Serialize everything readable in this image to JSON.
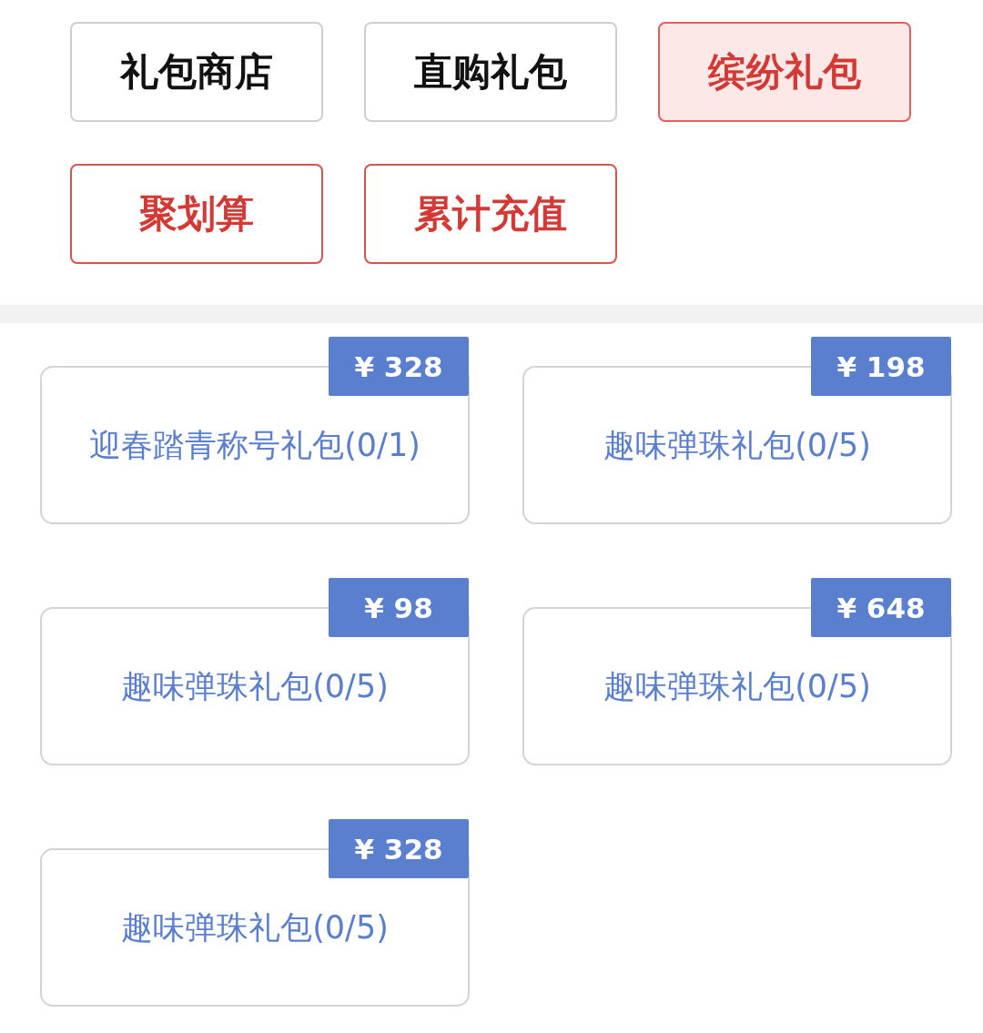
{
  "tabs": [
    {
      "label": "礼包商店",
      "kind": "plain",
      "selected": false
    },
    {
      "label": "直购礼包",
      "kind": "plain",
      "selected": false
    },
    {
      "label": "缤纷礼包",
      "kind": "plain",
      "selected": true
    },
    {
      "label": "聚划算",
      "kind": "highlight",
      "selected": false
    },
    {
      "label": "累计充值",
      "kind": "highlight",
      "selected": false
    }
  ],
  "packs": [
    {
      "price": "¥ 328",
      "title": "迎春踏青称号礼包(0/1)"
    },
    {
      "price": "¥ 198",
      "title": "趣味弹珠礼包(0/5)"
    },
    {
      "price": "¥ 98",
      "title": "趣味弹珠礼包(0/5)"
    },
    {
      "price": "¥ 648",
      "title": "趣味弹珠礼包(0/5)"
    },
    {
      "price": "¥ 328",
      "title": "趣味弹珠礼包(0/5)"
    }
  ]
}
